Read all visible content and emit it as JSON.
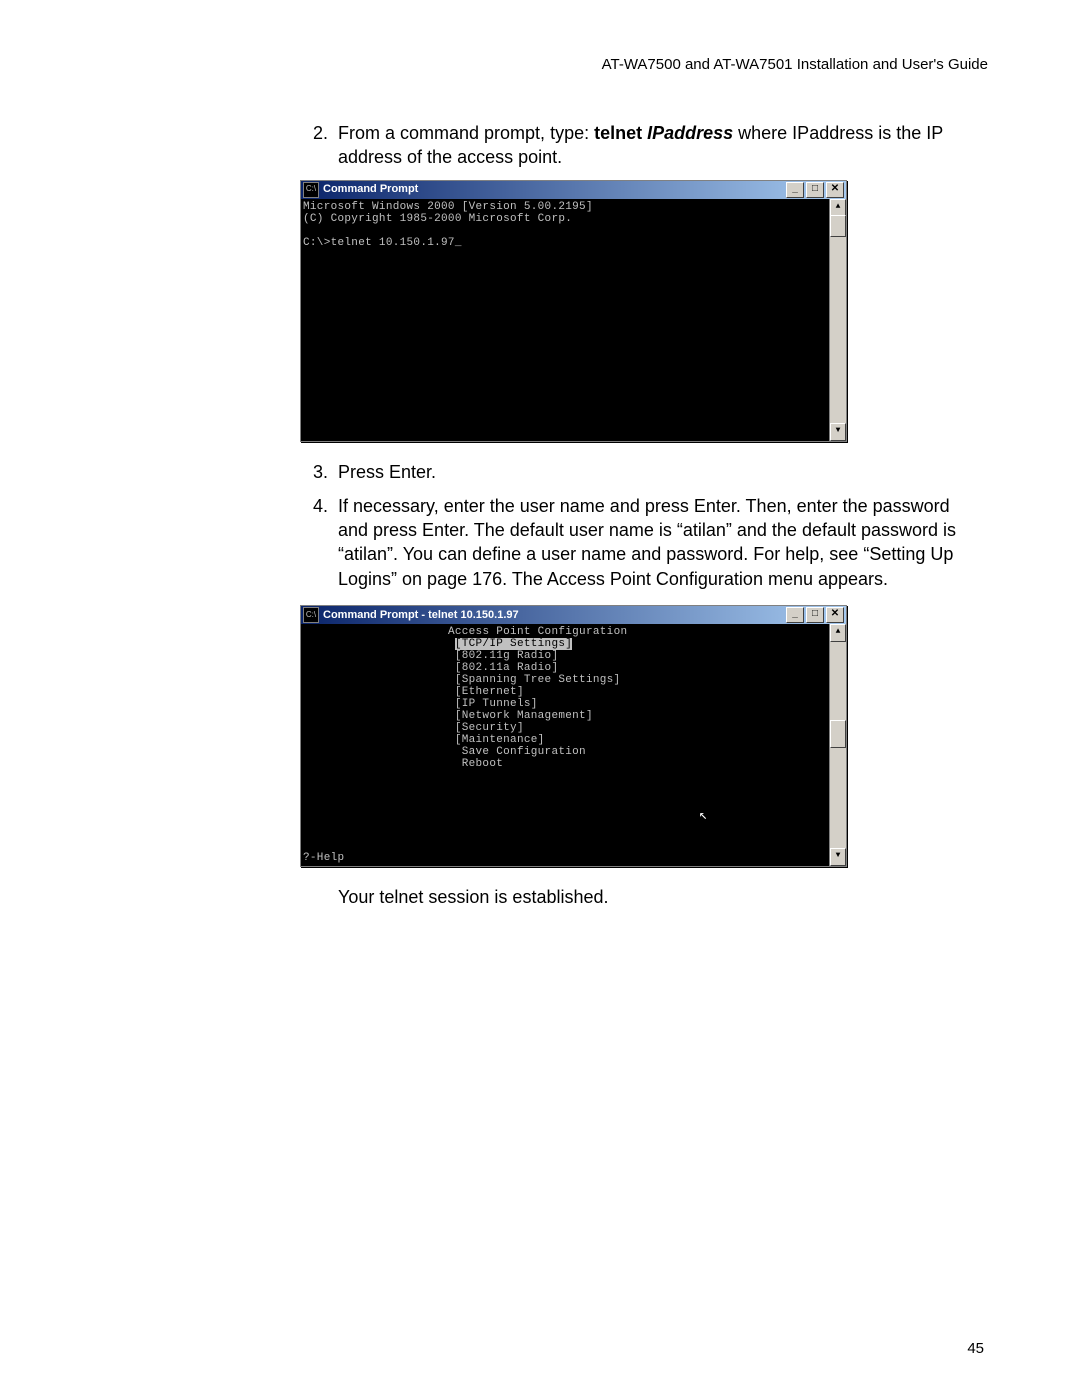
{
  "header": {
    "running_title": "AT-WA7500 and AT-WA7501 Installation and User's Guide"
  },
  "steps": {
    "s2_num": "2.",
    "s2_pre": "From a command prompt, type: ",
    "s2_bold": "telnet ",
    "s2_ital": "IPaddress",
    "s2_post": " where IPaddress is the IP address of the access point.",
    "s3_num": "3.",
    "s3_text": "Press Enter.",
    "s4_num": "4.",
    "s4_text": "If necessary, enter the user name and press Enter. Then, enter the password and press Enter. The default user name is “atilan” and the default password is “atilan”. You can define a user name and password. For help, see “Setting Up Logins” on page 176. The Access Point Configuration menu appears.",
    "closing": "Your telnet session is established."
  },
  "cmd1": {
    "title": "Command Prompt",
    "icon_label": "C:\\",
    "line1": "Microsoft Windows 2000 [Version 5.00.2195]",
    "line2": "(C) Copyright 1985-2000 Microsoft Corp.",
    "line3": "",
    "line4": "C:\\>telnet 10.150.1.97_",
    "min": "_",
    "max": "□",
    "close": "✕",
    "up": "▲",
    "down": "▼"
  },
  "cmd2": {
    "title": "Command Prompt - telnet 10.150.1.97",
    "icon_label": "C:\\",
    "min": "_",
    "max": "□",
    "close": "✕",
    "up": "▲",
    "down": "▼",
    "menu_title": "Access Point Configuration",
    "items": {
      "tcpip": "[TCP/IP Settings]",
      "g": "[802.11g Radio]",
      "a": "[802.11a Radio]",
      "span": "[Spanning Tree Settings]",
      "eth": "[Ethernet]",
      "tun": "[IP Tunnels]",
      "netm": "[Network Management]",
      "sec": "[Security]",
      "maint": "[Maintenance]",
      "save": " Save Configuration",
      "reboot": " Reboot"
    },
    "help": "?-Help"
  },
  "page_number": "45"
}
